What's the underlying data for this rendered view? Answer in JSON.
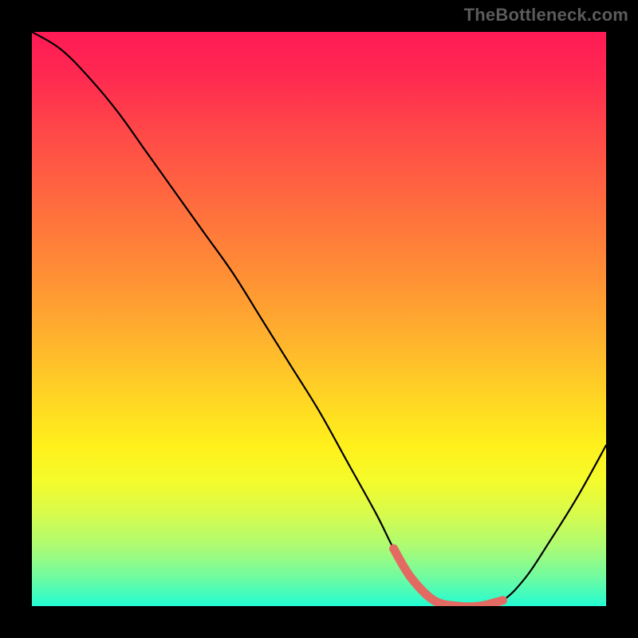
{
  "attribution": "TheBottleneck.com",
  "chart_data": {
    "type": "line",
    "title": "",
    "xlabel": "",
    "ylabel": "",
    "xlim": [
      0,
      100
    ],
    "ylim": [
      0,
      100
    ],
    "series": [
      {
        "name": "bottleneck-curve",
        "x": [
          0,
          5,
          10,
          15,
          20,
          25,
          30,
          35,
          40,
          45,
          50,
          55,
          60,
          63,
          66,
          70,
          74,
          78,
          82,
          86,
          90,
          95,
          100
        ],
        "values": [
          100,
          97,
          92,
          86,
          79,
          72,
          65,
          58,
          50,
          42,
          34,
          25,
          16,
          10,
          5,
          1,
          0,
          0,
          1,
          5,
          11,
          19,
          28
        ]
      }
    ],
    "highlight": {
      "name": "optimal-band",
      "color": "#e36a63",
      "x": [
        63,
        66,
        70,
        74,
        78,
        82
      ],
      "values": [
        10,
        5,
        1,
        0,
        0,
        1
      ]
    },
    "gradient_stops": [
      {
        "offset": 0.0,
        "color": "#ff1a55"
      },
      {
        "offset": 0.08,
        "color": "#ff2a50"
      },
      {
        "offset": 0.18,
        "color": "#ff4a48"
      },
      {
        "offset": 0.3,
        "color": "#ff6c3e"
      },
      {
        "offset": 0.42,
        "color": "#ff8e35"
      },
      {
        "offset": 0.54,
        "color": "#ffb42d"
      },
      {
        "offset": 0.64,
        "color": "#ffd624"
      },
      {
        "offset": 0.72,
        "color": "#fff01c"
      },
      {
        "offset": 0.78,
        "color": "#f5fb2a"
      },
      {
        "offset": 0.84,
        "color": "#d7fb4d"
      },
      {
        "offset": 0.9,
        "color": "#a9fb76"
      },
      {
        "offset": 0.95,
        "color": "#6ffba1"
      },
      {
        "offset": 1.0,
        "color": "#23fcd3"
      }
    ]
  }
}
